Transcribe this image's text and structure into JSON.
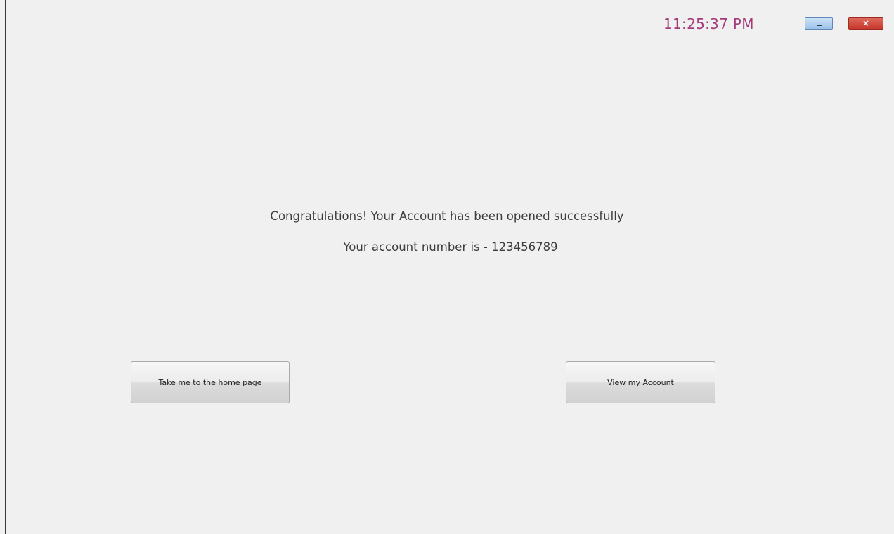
{
  "header": {
    "clock": "11:25:37 PM",
    "minimize_icon": "minimize-icon",
    "close_icon": "close-icon",
    "close_glyph": "×"
  },
  "message": {
    "congrats": "Congratulations! Your Account has been opened successfully",
    "account_number": "Your account number is - 123456789"
  },
  "buttons": {
    "home": "Take me to the home page",
    "view_account": "View my Account"
  },
  "colors": {
    "background": "#f0f0f0",
    "clock_text": "#a33a7a",
    "close_button": "#c7372c",
    "minimize_button": "#9cc2ea"
  }
}
